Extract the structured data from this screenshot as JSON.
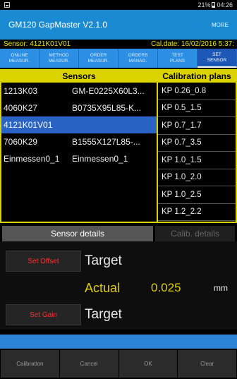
{
  "status_bar": {
    "battery": "21%",
    "time": "04:26"
  },
  "app": {
    "title": "GM120 GapMaster V2.1.0",
    "more": "MORE"
  },
  "info": {
    "sensor": "Sensor: 4121K01V01",
    "cal_date": "Cal.date: 16/02/2016 5:37:"
  },
  "tabs": [
    {
      "line1": "ONLINE",
      "line2": "MEASUR."
    },
    {
      "line1": "METHOD",
      "line2": "MEASUR."
    },
    {
      "line1": "ORDER",
      "line2": "MEASUR."
    },
    {
      "line1": "ORDERS",
      "line2": "MANAG."
    },
    {
      "line1": "TEST",
      "line2": "PLANS"
    },
    {
      "line1": "SET",
      "line2": "SENSOR"
    }
  ],
  "sensors": {
    "header": "Sensors",
    "rows": [
      {
        "code": "1213K03",
        "type": "GM-E0225X60L3..."
      },
      {
        "code": "4060K27",
        "type": "B0735X95L85-K..."
      },
      {
        "code": "4121K01V01",
        "type": ""
      },
      {
        "code": "7060K29",
        "type": "B1555X127L85-..."
      },
      {
        "code": "Einmessen0_1",
        "type": "Einmessen0_1"
      }
    ]
  },
  "plans": {
    "header": "Calibration plans",
    "rows": [
      "KP 0.26_0.8",
      "KP 0.5_1.5",
      "KP 0.7_1.7",
      "KP 0.7_3.5",
      "KP 1.0_1.5",
      "KP 1.0_2.0",
      "KP 1.0_2.5",
      "KP 1.2_2.2"
    ]
  },
  "details": {
    "tab_sensor": "Sensor details",
    "tab_calib": "Calib. details",
    "set_offset": "Set Offset",
    "set_gain": "Set Gain",
    "target": "Target",
    "actual": "Actual",
    "actual_value": "0.025",
    "unit": "mm"
  },
  "bottom": {
    "calibration": "Calibration",
    "cancel": "Cancel",
    "ok": "OK",
    "clear": "Clear"
  },
  "colors": {
    "accent_blue": "#1a8bd3",
    "highlight_yellow": "#dcd400",
    "selection_blue": "#2a63c2",
    "alert_red": "#ff3030"
  }
}
